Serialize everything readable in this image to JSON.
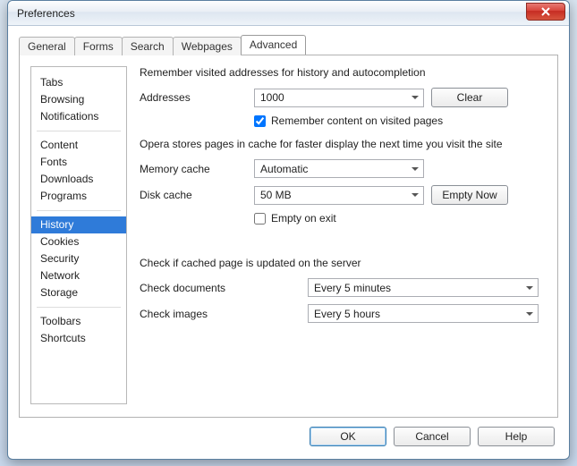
{
  "window": {
    "title": "Preferences"
  },
  "tabs": [
    "General",
    "Forms",
    "Search",
    "Webpages",
    "Advanced"
  ],
  "active_tab_index": 4,
  "sidebar": {
    "groups": [
      [
        "Tabs",
        "Browsing",
        "Notifications"
      ],
      [
        "Content",
        "Fonts",
        "Downloads",
        "Programs"
      ],
      [
        "History",
        "Cookies",
        "Security",
        "Network",
        "Storage"
      ],
      [
        "Toolbars",
        "Shortcuts"
      ]
    ],
    "selected": "History"
  },
  "pane": {
    "heading_history": "Remember visited addresses for history and autocompletion",
    "addresses_label": "Addresses",
    "addresses_value": "1000",
    "clear_label": "Clear",
    "remember_content_label": "Remember content on visited pages",
    "remember_content_checked": true,
    "heading_cache": "Opera stores pages in cache for faster display the next time you visit the site",
    "memory_cache_label": "Memory cache",
    "memory_cache_value": "Automatic",
    "disk_cache_label": "Disk cache",
    "disk_cache_value": "50 MB",
    "empty_now_label": "Empty Now",
    "empty_on_exit_label": "Empty on exit",
    "empty_on_exit_checked": false,
    "heading_update": "Check if cached page is updated on the server",
    "check_documents_label": "Check documents",
    "check_documents_value": "Every 5 minutes",
    "check_images_label": "Check images",
    "check_images_value": "Every 5 hours"
  },
  "footer": {
    "ok": "OK",
    "cancel": "Cancel",
    "help": "Help"
  }
}
